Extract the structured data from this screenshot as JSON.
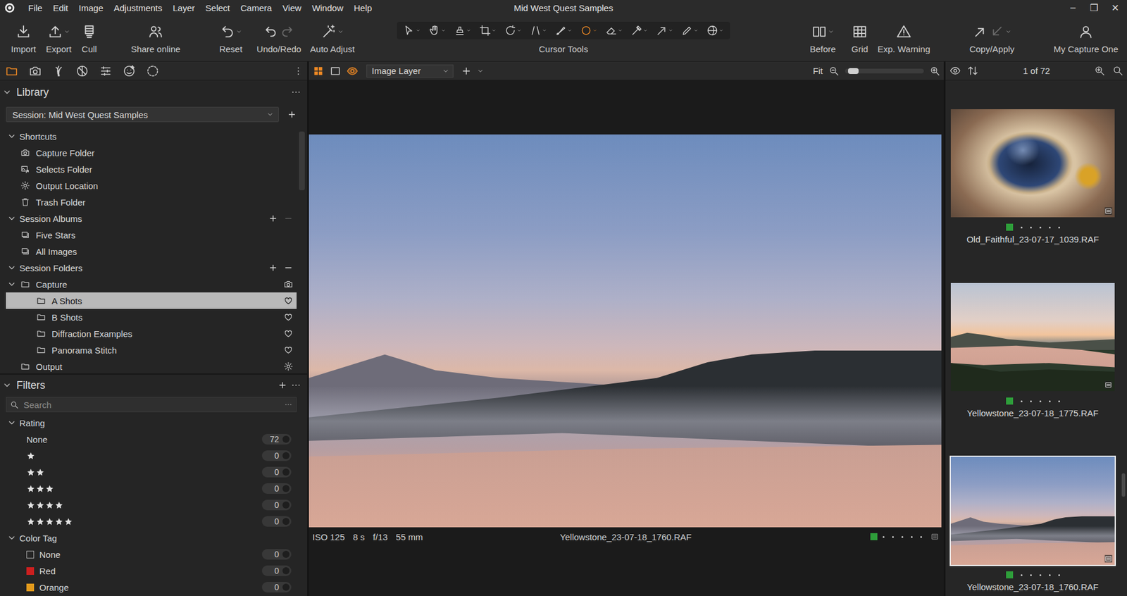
{
  "window": {
    "title": "Mid West Quest Samples",
    "controls": [
      "–",
      "❐",
      "✕"
    ]
  },
  "menu": [
    "File",
    "Edit",
    "Image",
    "Adjustments",
    "Layer",
    "Select",
    "Camera",
    "View",
    "Window",
    "Help"
  ],
  "toolbar": {
    "left": [
      {
        "label": "Import",
        "kind": "import",
        "dropdown": false
      },
      {
        "label": "Export",
        "kind": "export",
        "dropdown": true
      },
      {
        "label": "Cull",
        "kind": "cull",
        "dropdown": false
      },
      {
        "label": "Share online",
        "kind": "share",
        "dropdown": false
      },
      {
        "label": "Reset",
        "kind": "reset",
        "dropdown": true
      },
      {
        "label": "Undo/Redo",
        "kind": "undo-redo",
        "dropdown": false,
        "redo_enabled": false
      },
      {
        "label": "Auto Adjust",
        "kind": "auto-adjust",
        "dropdown": true
      }
    ],
    "cursor_tools": {
      "label": "Cursor Tools",
      "tools": [
        {
          "kind": "select",
          "selected": false
        },
        {
          "kind": "hand",
          "selected": false
        },
        {
          "kind": "stamp",
          "selected": false
        },
        {
          "kind": "crop",
          "selected": false
        },
        {
          "kind": "rotate",
          "selected": false
        },
        {
          "kind": "keystone",
          "selected": false
        },
        {
          "kind": "brush",
          "selected": false
        },
        {
          "kind": "circle",
          "selected": true
        },
        {
          "kind": "eraser",
          "selected": false
        },
        {
          "kind": "picker",
          "selected": false
        },
        {
          "kind": "arrow",
          "selected": false
        },
        {
          "kind": "pen",
          "selected": false
        },
        {
          "kind": "spot",
          "selected": false
        }
      ]
    },
    "right": [
      {
        "label": "Before",
        "kind": "before",
        "dropdown": true
      },
      {
        "label": "Grid",
        "kind": "grid",
        "dropdown": false
      },
      {
        "label": "Exp. Warning",
        "kind": "warning",
        "dropdown": false
      },
      {
        "label": "Copy/Apply",
        "kind": "copy-apply",
        "dropdown": true,
        "apply_enabled": false
      },
      {
        "label": "My Capture One",
        "kind": "account",
        "dropdown": false
      }
    ]
  },
  "tool_tabs": [
    {
      "kind": "folder",
      "selected": true
    },
    {
      "kind": "camera",
      "selected": false
    },
    {
      "kind": "lens",
      "selected": false
    },
    {
      "kind": "color",
      "selected": false
    },
    {
      "kind": "sliders",
      "selected": false
    },
    {
      "kind": "face",
      "selected": false
    },
    {
      "kind": "dashed",
      "selected": false
    }
  ],
  "library": {
    "title": "Library",
    "session": "Session: Mid West Quest Samples",
    "sections": [
      {
        "title": "Shortcuts",
        "expanded": true,
        "actions": [],
        "items": [
          {
            "label": "Capture Folder",
            "kind": "shortcut-capture",
            "depth": 0,
            "selected": false
          },
          {
            "label": "Selects Folder",
            "kind": "shortcut-selects",
            "depth": 0,
            "selected": false
          },
          {
            "label": "Output Location",
            "kind": "shortcut-output",
            "depth": 0,
            "selected": false
          },
          {
            "label": "Trash Folder",
            "kind": "shortcut-trash",
            "depth": 0,
            "selected": false
          }
        ]
      },
      {
        "title": "Session Albums",
        "expanded": true,
        "actions": [
          {
            "kind": "add",
            "disabled": false
          },
          {
            "kind": "remove",
            "disabled": true
          }
        ],
        "items": [
          {
            "label": "Five Stars",
            "kind": "album",
            "depth": 0,
            "selected": false
          },
          {
            "label": "All Images",
            "kind": "album",
            "depth": 0,
            "selected": false
          }
        ]
      },
      {
        "title": "Session Folders",
        "expanded": true,
        "actions": [
          {
            "kind": "add",
            "disabled": false
          },
          {
            "kind": "remove",
            "disabled": false
          }
        ],
        "items": [
          {
            "label": "Capture",
            "kind": "capture-folder",
            "depth": 0,
            "selected": false,
            "expanded": true
          },
          {
            "label": "A Shots",
            "kind": "subfolder",
            "depth": 1,
            "selected": true
          },
          {
            "label": "B Shots",
            "kind": "subfolder",
            "depth": 1,
            "selected": false
          },
          {
            "label": "Diffraction Examples",
            "kind": "subfolder",
            "depth": 1,
            "selected": false
          },
          {
            "label": "Panorama Stitch",
            "kind": "subfolder",
            "depth": 1,
            "selected": false
          },
          {
            "label": "Output",
            "kind": "output-folder",
            "depth": 0,
            "selected": false
          }
        ]
      }
    ]
  },
  "filters": {
    "title": "Filters",
    "search": {
      "placeholder": "Search"
    },
    "groups": [
      {
        "title": "Rating",
        "expanded": true,
        "rows": [
          {
            "kind": "text",
            "label": "None",
            "count": "72"
          },
          {
            "kind": "stars",
            "stars": 1,
            "count": "0"
          },
          {
            "kind": "stars",
            "stars": 2,
            "count": "0"
          },
          {
            "kind": "stars",
            "stars": 3,
            "count": "0"
          },
          {
            "kind": "stars",
            "stars": 4,
            "count": "0"
          },
          {
            "kind": "stars",
            "stars": 5,
            "count": "0"
          }
        ]
      },
      {
        "title": "Color Tag",
        "expanded": true,
        "rows": [
          {
            "kind": "tag",
            "label": "None",
            "count": "0"
          },
          {
            "kind": "tag",
            "label": "Red",
            "count": "0",
            "color": "#cc1f1f"
          },
          {
            "kind": "tag",
            "label": "Orange",
            "count": "0",
            "color": "#e39a1c"
          }
        ]
      }
    ]
  },
  "viewer": {
    "view_modes": [
      {
        "kind": "grid-view",
        "selected": true
      },
      {
        "kind": "single-view",
        "selected": false
      },
      {
        "kind": "proof-view",
        "selected": true
      }
    ],
    "layer": "Image Layer",
    "zoom": {
      "label": "Fit",
      "level": 0.04
    },
    "photo": "misty-lake",
    "info": {
      "iso": "ISO 125",
      "shutter": "8 s",
      "aperture": "f/13",
      "focal": "55 mm",
      "filename": "Yellowstone_23-07-18_1760.RAF",
      "color": "#2e9e3a",
      "stars": 0
    }
  },
  "browser": {
    "count": "1 of 72",
    "scroll": 0.76,
    "thumbnails": [
      {
        "filename": "Old_Faithful_23-07-17_1039.RAF",
        "kind": "geyser",
        "color": "#2e9e3a",
        "stars": 0,
        "selected": false
      },
      {
        "filename": "Yellowstone_23-07-18_1775.RAF",
        "kind": "river-sunset",
        "color": "#2e9e3a",
        "stars": 0,
        "selected": false
      },
      {
        "filename": "Yellowstone_23-07-18_1760.RAF",
        "kind": "misty-lake",
        "color": "#2e9e3a",
        "stars": 0,
        "selected": true
      }
    ]
  }
}
